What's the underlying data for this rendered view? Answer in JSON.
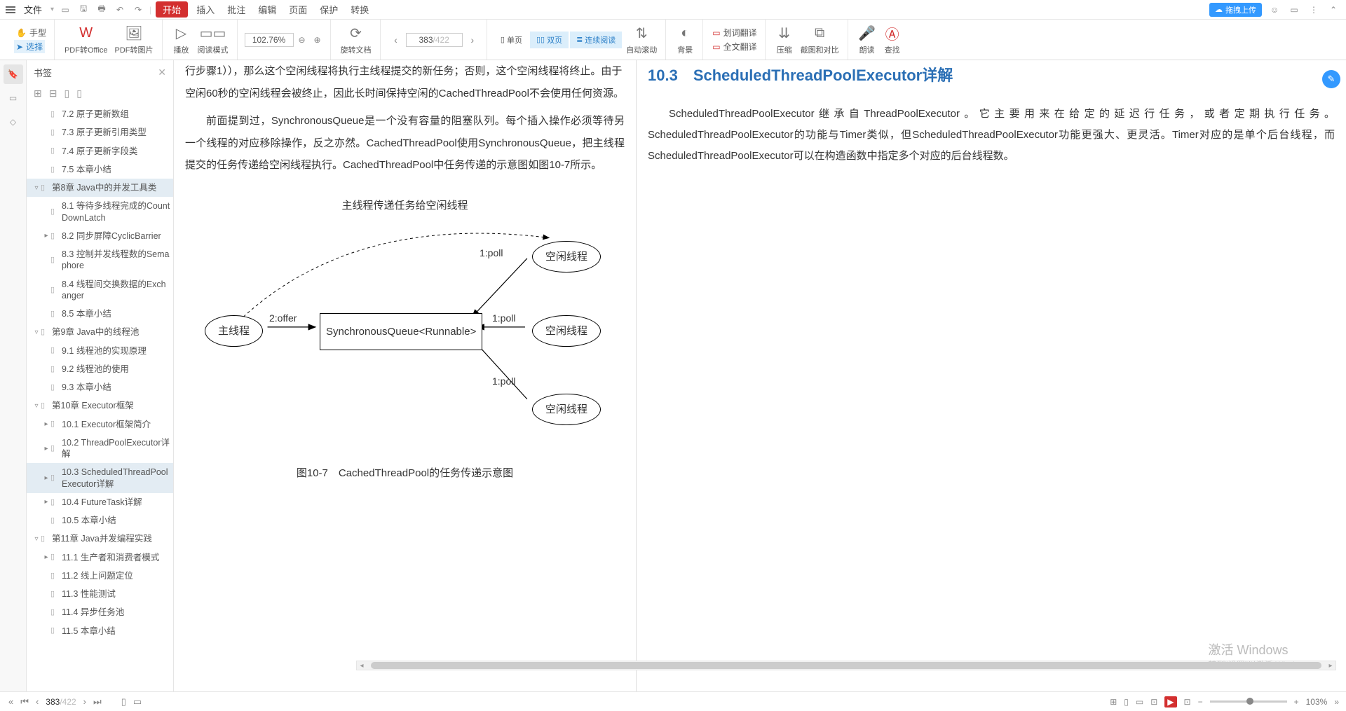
{
  "menubar": {
    "file": "文件",
    "items": [
      "开始",
      "插入",
      "批注",
      "编辑",
      "页面",
      "保护",
      "转换"
    ],
    "upload": "拖拽上传"
  },
  "toolbar": {
    "hand": "手型",
    "select": "选择",
    "pdf_office": "PDF转Office",
    "pdf_image": "PDF转图片",
    "play": "播放",
    "read_mode": "阅读模式",
    "zoom": "102.76%",
    "rotate": "旋转文档",
    "page_current": "383",
    "page_total": "/422",
    "single": "单页",
    "double": "双页",
    "continuous": "连续阅读",
    "auto_scroll": "自动滚动",
    "background": "背景",
    "word_trans": "划词翻译",
    "full_trans": "全文翻译",
    "compress": "压缩",
    "crop": "截图和对比",
    "read_aloud": "朗读",
    "find": "查找"
  },
  "sidebar": {
    "title": "书签",
    "items": [
      {
        "level": 2,
        "arrow": "",
        "label": "7.2 原子更新数组"
      },
      {
        "level": 2,
        "arrow": "",
        "label": "7.3 原子更新引用类型"
      },
      {
        "level": 2,
        "arrow": "",
        "label": "7.4 原子更新字段类"
      },
      {
        "level": 2,
        "arrow": "",
        "label": "7.5 本章小结"
      },
      {
        "level": 1,
        "arrow": "▿",
        "label": "第8章 Java中的并发工具类",
        "selected": true
      },
      {
        "level": 2,
        "arrow": "",
        "label": "8.1 等待多线程完成的CountDownLatch"
      },
      {
        "level": 2,
        "arrow": "▸",
        "label": "8.2 同步屏障CyclicBarrier"
      },
      {
        "level": 2,
        "arrow": "",
        "label": "8.3 控制并发线程数的Semaphore"
      },
      {
        "level": 2,
        "arrow": "",
        "label": "8.4 线程间交换数据的Exchanger"
      },
      {
        "level": 2,
        "arrow": "",
        "label": "8.5 本章小结"
      },
      {
        "level": 1,
        "arrow": "▿",
        "label": "第9章 Java中的线程池"
      },
      {
        "level": 2,
        "arrow": "",
        "label": "9.1 线程池的实现原理"
      },
      {
        "level": 2,
        "arrow": "",
        "label": "9.2 线程池的使用"
      },
      {
        "level": 2,
        "arrow": "",
        "label": "9.3 本章小结"
      },
      {
        "level": 1,
        "arrow": "▿",
        "label": "第10章 Executor框架"
      },
      {
        "level": 2,
        "arrow": "▸",
        "label": "10.1 Executor框架简介"
      },
      {
        "level": 2,
        "arrow": "▸",
        "label": "10.2 ThreadPoolExecutor详解"
      },
      {
        "level": 2,
        "arrow": "▸",
        "label": "10.3 ScheduledThreadPoolExecutor详解",
        "selected": true
      },
      {
        "level": 2,
        "arrow": "▸",
        "label": "10.4 FutureTask详解"
      },
      {
        "level": 2,
        "arrow": "",
        "label": "10.5 本章小结"
      },
      {
        "level": 1,
        "arrow": "▿",
        "label": "第11章 Java并发编程实践"
      },
      {
        "level": 2,
        "arrow": "▸",
        "label": "11.1 生产者和消费者模式"
      },
      {
        "level": 2,
        "arrow": "",
        "label": "11.2 线上问题定位"
      },
      {
        "level": 2,
        "arrow": "",
        "label": "11.3 性能测试"
      },
      {
        "level": 2,
        "arrow": "",
        "label": "11.4 异步任务池"
      },
      {
        "level": 2,
        "arrow": "",
        "label": "11.5 本章小结"
      }
    ]
  },
  "page_left": {
    "p1": "行步骤1）），那么这个空闲线程将执行主线程提交的新任务；否则，这个空闲线程将终止。由于",
    "p2": "空闲60秒的空闲线程会被终止，因此长时间保持空闲的CachedThreadPool不会使用任何资源。",
    "p3": "前面提到过，SynchronousQueue是一个没有容量的阻塞队列。每个插入操作必须等待另一个线程的对应移除操作，反之亦然。CachedThreadPool使用SynchronousQueue，把主线程提交的任务传递给空闲线程执行。CachedThreadPool中任务传递的示意图如图10-7所示。",
    "diagram": {
      "title": "主线程传递任务给空闲线程",
      "main_thread": "主线程",
      "queue": "SynchronousQueue<Runnable>",
      "idle1": "空闲线程",
      "idle2": "空闲线程",
      "idle3": "空闲线程",
      "offer": "2:offer",
      "poll1": "1:poll",
      "poll2": "1:poll",
      "poll3": "1:poll"
    },
    "caption": "图10-7　CachedThreadPool的任务传递示意图"
  },
  "page_right": {
    "title": "10.3　ScheduledThreadPoolExecutor详解",
    "p1": "ScheduledThreadPoolExecutor继承自ThreadPoolExecutor。它主要用来在给定的延迟行任务，或者定期执行任务。ScheduledThreadPoolExecutor的功能与Timer类似，但ScheduledThreadPoolExecutor功能更强大、更灵活。Timer对应的是单个后台线程，而ScheduledThreadPoolExecutor可以在构造函数中指定多个对应的后台线程数。"
  },
  "watermark": {
    "line1": "激活 Windows",
    "line2": "转到\"设置\"以激活 Windows。"
  },
  "statusbar": {
    "page_current": "383",
    "page_total": "/422",
    "zoom": "103%"
  }
}
